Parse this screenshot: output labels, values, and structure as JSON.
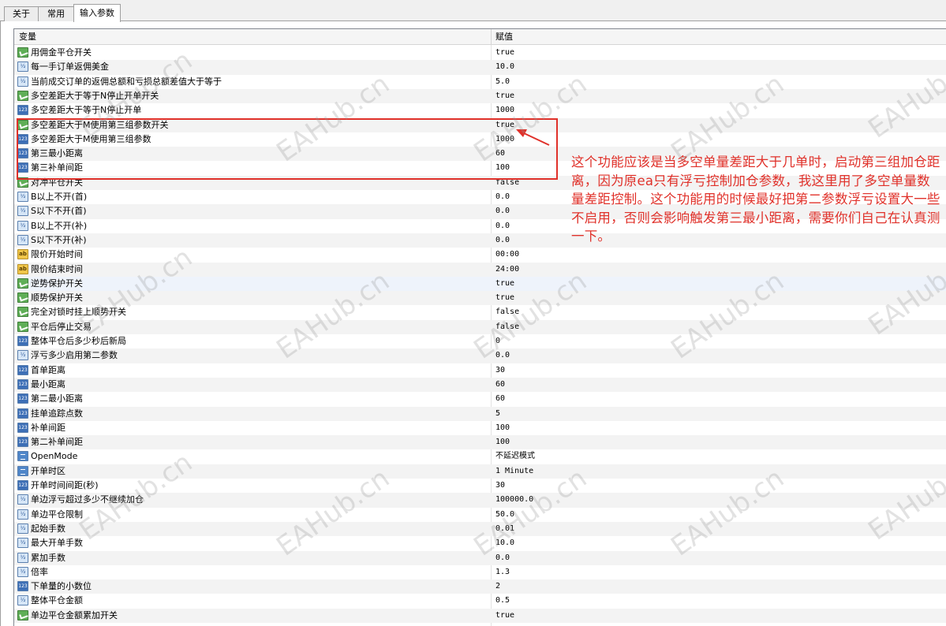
{
  "tabs": [
    {
      "label": "关于"
    },
    {
      "label": "常用"
    },
    {
      "label": "输入参数"
    }
  ],
  "table": {
    "col_variable": "变量",
    "col_value": "赋值",
    "rows": [
      {
        "name": "用佣金平仓开关",
        "value": "true",
        "type": "bool"
      },
      {
        "name": "每一手订单返佣美金",
        "value": "10.0",
        "type": "double"
      },
      {
        "name": "当前成交订单的返佣总额和亏损总额差值大于等于",
        "value": "5.0",
        "type": "double"
      },
      {
        "name": "多空差距大于等于N停止开单开关",
        "value": "true",
        "type": "bool"
      },
      {
        "name": "多空差距大于等于N停止开单",
        "value": "1000",
        "type": "int"
      },
      {
        "name": "多空差距大于M使用第三组参数开关",
        "value": "true",
        "type": "bool"
      },
      {
        "name": "多空差距大于M使用第三组参数",
        "value": "1000",
        "type": "int"
      },
      {
        "name": "第三最小距离",
        "value": "60",
        "type": "int"
      },
      {
        "name": "第三补单间距",
        "value": "100",
        "type": "int"
      },
      {
        "name": "对冲平仓开关",
        "value": "false",
        "type": "bool"
      },
      {
        "name": "B以上不开(首)",
        "value": "0.0",
        "type": "double"
      },
      {
        "name": "S以下不开(首)",
        "value": "0.0",
        "type": "double"
      },
      {
        "name": "B以上不开(补)",
        "value": "0.0",
        "type": "double"
      },
      {
        "name": "S以下不开(补)",
        "value": "0.0",
        "type": "double"
      },
      {
        "name": "限价开始时间",
        "value": "00:00",
        "type": "string"
      },
      {
        "name": "限价结束时间",
        "value": "24:00",
        "type": "string"
      },
      {
        "name": "逆势保护开关",
        "value": "true",
        "type": "bool"
      },
      {
        "name": "顺势保护开关",
        "value": "true",
        "type": "bool"
      },
      {
        "name": "完全对锁时挂上顺势开关",
        "value": "false",
        "type": "bool"
      },
      {
        "name": "平仓后停止交易",
        "value": "false",
        "type": "bool"
      },
      {
        "name": "整体平仓后多少秒后新局",
        "value": "0",
        "type": "int"
      },
      {
        "name": "浮亏多少启用第二参数",
        "value": "0.0",
        "type": "double"
      },
      {
        "name": "首单距离",
        "value": "30",
        "type": "int"
      },
      {
        "name": "最小距离",
        "value": "60",
        "type": "int"
      },
      {
        "name": "第二最小距离",
        "value": "60",
        "type": "int"
      },
      {
        "name": "挂单追踪点数",
        "value": "5",
        "type": "int"
      },
      {
        "name": "补单间距",
        "value": "100",
        "type": "int"
      },
      {
        "name": "第二补单间距",
        "value": "100",
        "type": "int"
      },
      {
        "name": "OpenMode",
        "value": "不延迟模式",
        "type": "enum"
      },
      {
        "name": "开单时区",
        "value": "1 Minute",
        "type": "enum"
      },
      {
        "name": "开单时间间距(秒)",
        "value": "30",
        "type": "int"
      },
      {
        "name": "单边浮亏超过多少不继续加仓",
        "value": "100000.0",
        "type": "double"
      },
      {
        "name": "单边平仓限制",
        "value": "50.0",
        "type": "double"
      },
      {
        "name": "起始手数",
        "value": "0.01",
        "type": "double"
      },
      {
        "name": "最大开单手数",
        "value": "10.0",
        "type": "double"
      },
      {
        "name": "累加手数",
        "value": "0.0",
        "type": "double"
      },
      {
        "name": "倍率",
        "value": "1.3",
        "type": "double"
      },
      {
        "name": "下单量的小数位",
        "value": "2",
        "type": "int"
      },
      {
        "name": "整体平仓金额",
        "value": "0.5",
        "type": "double"
      },
      {
        "name": "单边平仓金额累加开关",
        "value": "true",
        "type": "bool"
      }
    ]
  },
  "icon_text": {
    "int": "123",
    "double": "½",
    "string": "ab"
  },
  "annotation": {
    "text": "这个功能应该是当多空单量差距大于几单时，启动第三组加仓距离，因为原ea只有浮亏控制加仓参数，我这里用了多空单量数量差距控制。这个功能用的时候最好把第二参数浮亏设置大一些不启用，否则会影响触发第三最小距离，需要你们自己在认真测一下。",
    "color": "#e0312a"
  },
  "watermark": "EAHub.cn"
}
